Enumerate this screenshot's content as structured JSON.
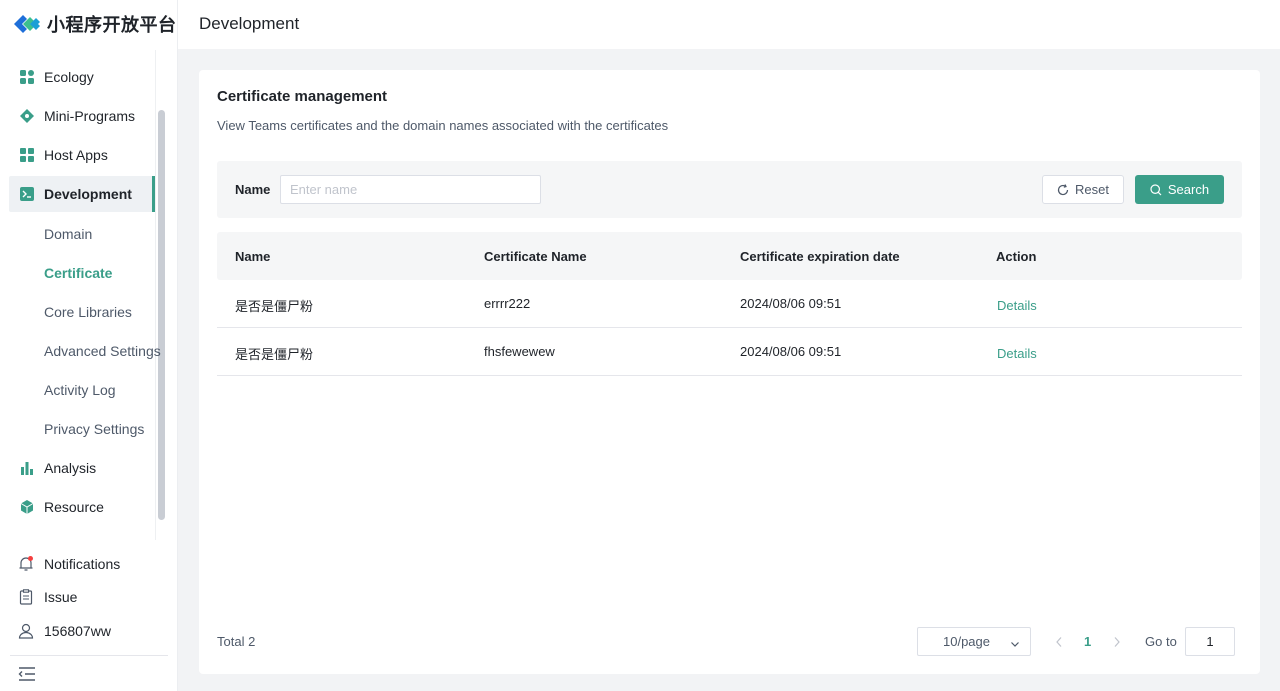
{
  "app": {
    "logo_text": "小程序开放平台",
    "accent_color": "#3a9e89"
  },
  "header": {
    "title": "Development"
  },
  "sidebar": {
    "items": [
      {
        "label": "Ecology",
        "icon": "grid-icon"
      },
      {
        "label": "Mini-Programs",
        "icon": "diamond-icon"
      },
      {
        "label": "Host Apps",
        "icon": "apps-icon"
      },
      {
        "label": "Development",
        "icon": "terminal-icon",
        "active": true
      },
      {
        "label": "Analysis",
        "icon": "bar-chart-icon"
      },
      {
        "label": "Resource",
        "icon": "cube-icon"
      }
    ],
    "sub_items": [
      {
        "label": "Domain"
      },
      {
        "label": "Certificate",
        "active": true
      },
      {
        "label": "Core Libraries"
      },
      {
        "label": "Advanced Settings"
      },
      {
        "label": "Activity Log"
      },
      {
        "label": "Privacy Settings"
      }
    ],
    "bottom": [
      {
        "label": "Notifications",
        "icon": "bell-icon"
      },
      {
        "label": "Issue",
        "icon": "clipboard-icon"
      },
      {
        "label": "156807ww",
        "icon": "user-icon"
      }
    ]
  },
  "card": {
    "title": "Certificate management",
    "description": "View Teams certificates and the domain names associated with the certificates"
  },
  "filter": {
    "name_label": "Name",
    "name_placeholder": "Enter name",
    "name_value": "",
    "reset_label": "Reset",
    "search_label": "Search"
  },
  "table": {
    "columns": [
      "Name",
      "Certificate Name",
      "Certificate expiration date",
      "Action"
    ],
    "rows": [
      {
        "name": "是否是僵尸粉",
        "cert_name": "errrr222",
        "expires": "2024/08/06 09:51",
        "action": "Details"
      },
      {
        "name": "是否是僵尸粉",
        "cert_name": "fhsfewewew",
        "expires": "2024/08/06 09:51",
        "action": "Details"
      }
    ]
  },
  "pagination": {
    "total": "Total 2",
    "page_size": "10/page",
    "current_page": "1",
    "goto_label": "Go to",
    "goto_value": "1"
  }
}
